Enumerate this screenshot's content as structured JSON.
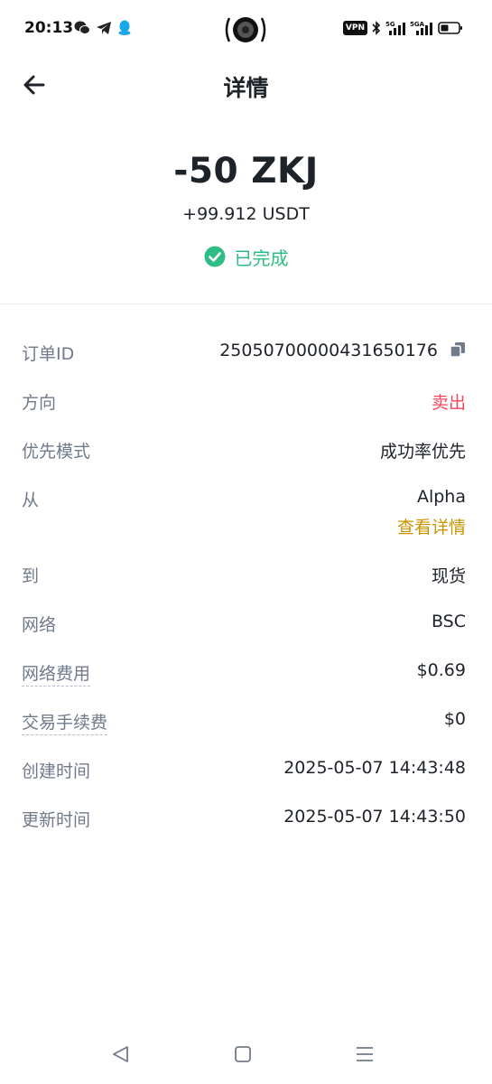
{
  "status_bar": {
    "time": "20:13",
    "vpn": "VPN",
    "icons": [
      "wechat-icon",
      "telegram-icon",
      "qq-icon",
      "bluetooth-icon",
      "signal-5g-icon",
      "signal-5ga-icon",
      "battery-icon"
    ]
  },
  "header": {
    "title": "详情"
  },
  "summary": {
    "amount": "-50 ZKJ",
    "received": "+99.912 USDT",
    "status": "已完成",
    "status_color": "#2ebd85"
  },
  "details": {
    "order_id": {
      "label": "订单ID",
      "value": "25050700000431650176"
    },
    "direction": {
      "label": "方向",
      "value": "卖出",
      "color": "#f6465d"
    },
    "priority": {
      "label": "优先模式",
      "value": "成功率优先"
    },
    "from": {
      "label": "从",
      "value": "Alpha",
      "link": "查看详情",
      "link_color": "#c99400"
    },
    "to": {
      "label": "到",
      "value": "现货"
    },
    "network": {
      "label": "网络",
      "value": "BSC"
    },
    "network_fee": {
      "label": "网络费用",
      "value": "$0.69"
    },
    "trading_fee": {
      "label": "交易手续费",
      "value": "$0"
    },
    "created": {
      "label": "创建时间",
      "value": "2025-05-07 14:43:48"
    },
    "updated": {
      "label": "更新时间",
      "value": "2025-05-07 14:43:50"
    }
  }
}
